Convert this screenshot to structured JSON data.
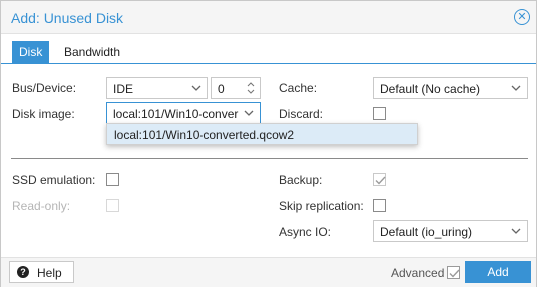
{
  "window": {
    "title": "Add: Unused Disk"
  },
  "tabs": [
    {
      "label": "Disk",
      "active": true
    },
    {
      "label": "Bandwidth",
      "active": false
    }
  ],
  "fields": {
    "bus_device": {
      "label": "Bus/Device:",
      "value": "IDE",
      "index": "0"
    },
    "disk_image": {
      "label": "Disk image:",
      "value": "local:101/Win10-conver"
    },
    "cache": {
      "label": "Cache:",
      "value": "Default (No cache)"
    },
    "discard": {
      "label": "Discard:",
      "checked": false
    },
    "ssd_emulation": {
      "label": "SSD emulation:",
      "checked": false
    },
    "read_only": {
      "label": "Read-only:",
      "checked": false,
      "disabled": true
    },
    "backup": {
      "label": "Backup:",
      "checked": true,
      "disabled": true
    },
    "skip_replication": {
      "label": "Skip replication:",
      "checked": false
    },
    "async_io": {
      "label": "Async IO:",
      "value": "Default (io_uring)"
    }
  },
  "dropdown": {
    "options": [
      "local:101/Win10-converted.qcow2"
    ]
  },
  "footer": {
    "help_label": "Help",
    "advanced_label": "Advanced",
    "advanced_checked": true,
    "add_label": "Add"
  },
  "colors": {
    "accent": "#3892d4",
    "dropdown_highlight": "#dcebf7"
  }
}
